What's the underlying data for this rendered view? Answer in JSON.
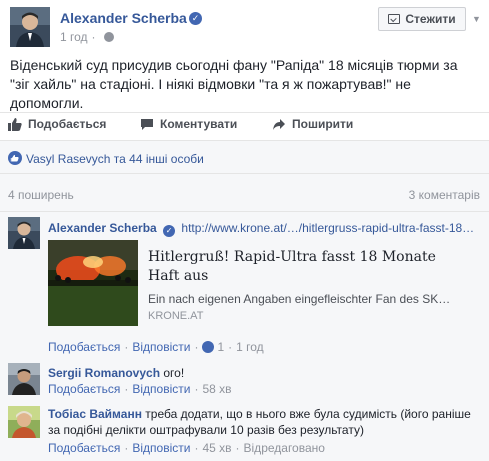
{
  "post": {
    "author": "Alexander Scherba",
    "time": "1 год",
    "follow_label": "Стежити",
    "text": "Віденський суд присудив сьогодні фану \"Рапіда\" 18 місяців тюрми за \"зіг хайль\" на стадіоні. І ніякі відмовки \"та я ж пожартував!\" не допомогли.",
    "actions": {
      "like": "Подобається",
      "comment": "Коментувати",
      "share": "Поширити"
    },
    "likes_text": "Vasyl Rasevych та 44 інші особи",
    "shares_count": "4 поширень",
    "comments_count": "3 коментарів"
  },
  "comments": [
    {
      "author": "Alexander Scherba",
      "text": "http://www.krone.at/…/hitlergruss-rapid-ultra-fasst-18…",
      "link": {
        "title": "Hitlergruß! Rapid-Ultra fasst 18 Monate Haft aus",
        "description": "Ein nach eigenen Angaben eingefleischter Fan des SK…",
        "domain": "KRONE.AT"
      },
      "like_label": "Подобається",
      "reply_label": "Відповісти",
      "reaction_count": "1",
      "time": "1 год"
    },
    {
      "author": "Sergii Romanovych",
      "text": "ого!",
      "like_label": "Подобається",
      "reply_label": "Відповісти",
      "time": "58 хв"
    },
    {
      "author": "Тобіас Вайманн",
      "text": "треба додати, що в нього вже була судимість (його раніше за подібні делікти оштрафували 10 разів без результату)",
      "like_label": "Подобається",
      "reply_label": "Відповісти",
      "time": "45 хв",
      "edited_label": "Відредаговано"
    }
  ],
  "colors": {
    "link": "#365899",
    "accent": "#4267b2",
    "meta": "#90949c",
    "bg_light": "#f6f7f9"
  },
  "icons": {
    "verified": "verified-badge-icon",
    "globe": "globe-icon",
    "follow": "follow-icon",
    "like": "thumbs-up-icon",
    "comment": "speech-bubble-icon",
    "share": "share-arrow-icon"
  }
}
